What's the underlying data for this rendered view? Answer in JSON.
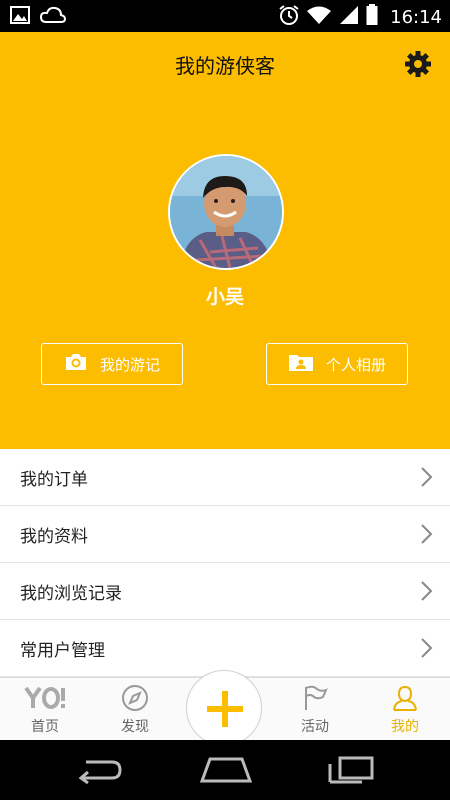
{
  "status_bar": {
    "time": "16:14",
    "icons": [
      "image-icon",
      "cloud-icon",
      "alarm-icon",
      "wifi-icon",
      "signal-icon",
      "battery-icon"
    ]
  },
  "header": {
    "title": "我的游侠客",
    "username": "小吴",
    "buttons": [
      {
        "label": "我的游记",
        "icon": "camera-icon"
      },
      {
        "label": "个人相册",
        "icon": "album-icon"
      }
    ],
    "background_color": "#fcbd00"
  },
  "menu": {
    "items": [
      {
        "label": "我的订单"
      },
      {
        "label": "我的资料"
      },
      {
        "label": "我的浏览记录"
      },
      {
        "label": "常用户管理"
      }
    ]
  },
  "tabbar": {
    "tabs": [
      {
        "label": "首页",
        "icon": "yo-logo-icon"
      },
      {
        "label": "发现",
        "icon": "compass-icon"
      },
      {
        "label": "活动",
        "icon": "flag-icon"
      },
      {
        "label": "我的",
        "icon": "person-icon",
        "active": true
      }
    ],
    "center_action": "plus-icon",
    "active_color": "#e8b200"
  },
  "navigation_bar": {
    "buttons": [
      "back-icon",
      "home-icon",
      "recents-icon"
    ]
  }
}
